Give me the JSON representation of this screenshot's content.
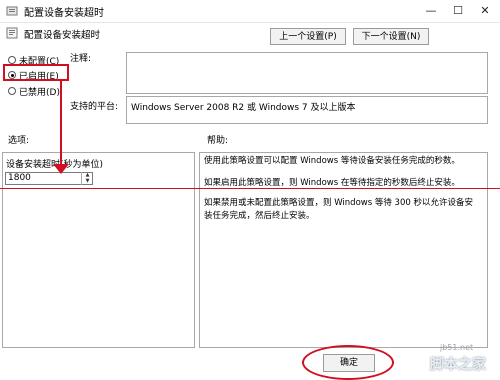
{
  "window": {
    "title": "配置设备安装超时",
    "controls": {
      "minimize": "—",
      "maximize": "☐",
      "close": "✕"
    }
  },
  "header": {
    "title": "配置设备安装超时",
    "prev_button": "上一个设置(P)",
    "next_button": "下一个设置(N)"
  },
  "state": {
    "not_configured": "未配置(C)",
    "enabled": "已启用(E)",
    "disabled": "已禁用(D)",
    "selected": "enabled"
  },
  "comment": {
    "label": "注释:",
    "value": ""
  },
  "platform": {
    "label": "支持的平台:",
    "value": "Windows Server 2008 R2 或 Windows 7 及以上版本"
  },
  "options": {
    "label": "选项:",
    "timeout_label": "设备安装超时(秒为单位)",
    "timeout_value": "1800"
  },
  "help": {
    "label": "帮助:",
    "paragraphs": [
      "使用此策略设置可以配置 Windows 等待设备安装任务完成的秒数。",
      "如果启用此策略设置，则 Windows 在等待指定的秒数后终止安装。",
      "如果禁用或未配置此策略设置，则 Windows 等待 300 秒以允许设备安装任务完成，然后终止安装。"
    ]
  },
  "footer": {
    "ok_button": "确定"
  },
  "watermark": {
    "url": "jb51.net",
    "name": "脚本之家"
  },
  "colors": {
    "annotation": "#d01020",
    "border": "#a8a8a8"
  }
}
